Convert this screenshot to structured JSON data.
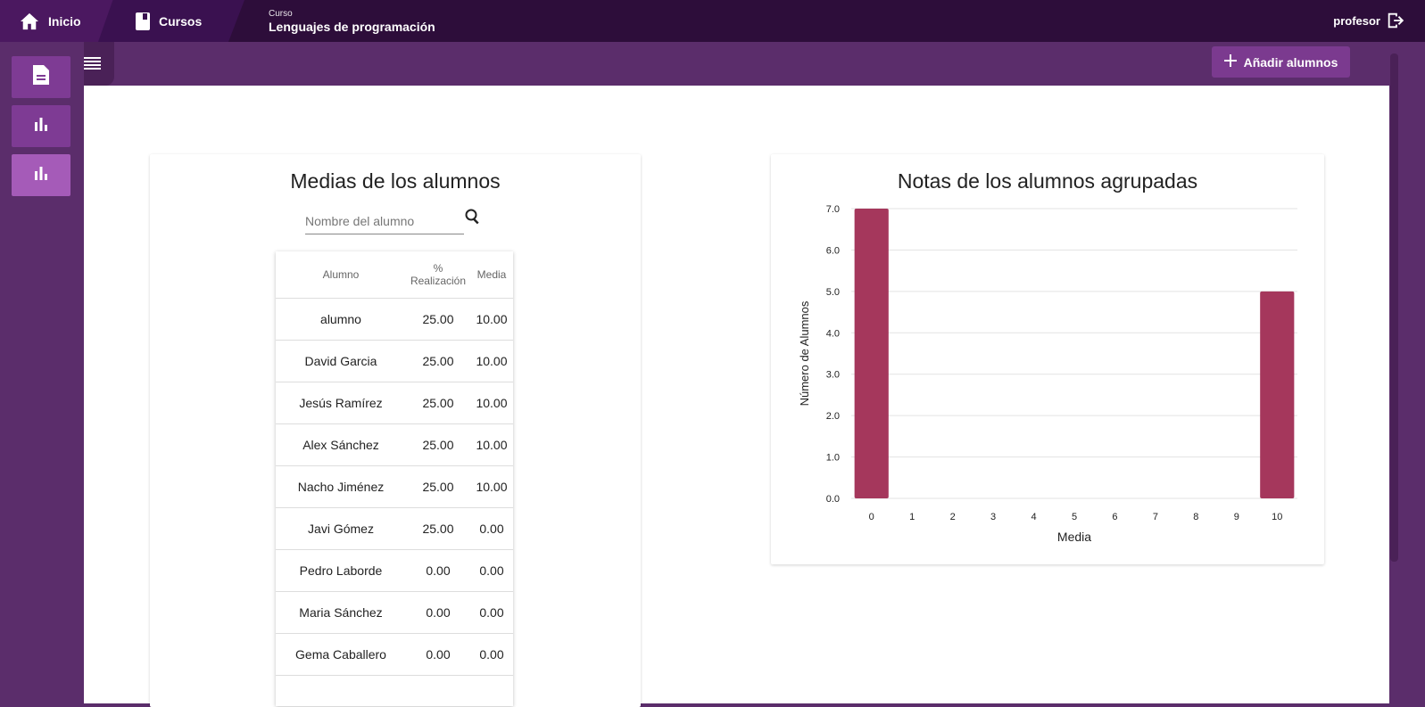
{
  "breadcrumb": {
    "home": "Inicio",
    "courses": "Cursos",
    "course_caption": "Curso",
    "course_name": "Lenguajes de programación"
  },
  "user": {
    "name": "profesor"
  },
  "toolbar": {
    "add_students": "Añadir alumnos"
  },
  "colors": {
    "topbar": "#2d0d3a",
    "accent": "#7b3a8f",
    "bar": "#a5375c"
  },
  "averages": {
    "title": "Medias de los alumnos",
    "search_placeholder": "Nombre del alumno",
    "columns": [
      "Alumno",
      "% Realización",
      "Media"
    ],
    "rows": [
      [
        "alumno",
        "25.00",
        "10.00"
      ],
      [
        "David Garcia",
        "25.00",
        "10.00"
      ],
      [
        "Jesús Ramírez",
        "25.00",
        "10.00"
      ],
      [
        "Alex Sánchez",
        "25.00",
        "10.00"
      ],
      [
        "Nacho Jiménez",
        "25.00",
        "10.00"
      ],
      [
        "Javi Gómez",
        "25.00",
        "0.00"
      ],
      [
        "Pedro Laborde",
        "0.00",
        "0.00"
      ],
      [
        "Maria Sánchez",
        "0.00",
        "0.00"
      ],
      [
        "Gema Caballero",
        "0.00",
        "0.00"
      ]
    ]
  },
  "grouped": {
    "title": "Notas de los alumnos agrupadas"
  },
  "chart_data": {
    "type": "bar",
    "title": "Notas de los alumnos agrupadas",
    "xlabel": "Media",
    "ylabel": "Número de Alumnos",
    "categories": [
      "0",
      "1",
      "2",
      "3",
      "4",
      "5",
      "6",
      "7",
      "8",
      "9",
      "10"
    ],
    "values": [
      7,
      0,
      0,
      0,
      0,
      0,
      0,
      0,
      0,
      0,
      5
    ],
    "ylim": [
      0,
      7
    ],
    "yticks": [
      "0.0",
      "1.0",
      "2.0",
      "3.0",
      "4.0",
      "5.0",
      "6.0",
      "7.0"
    ],
    "grid": true
  }
}
